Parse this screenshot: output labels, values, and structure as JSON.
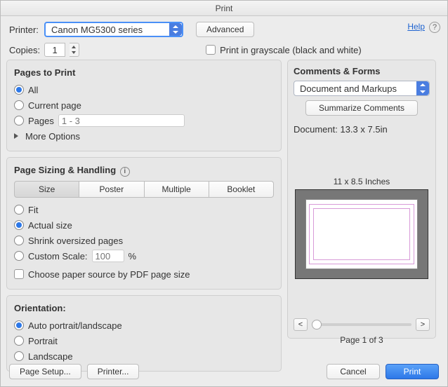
{
  "window": {
    "title": "Print"
  },
  "help": "Help",
  "top": {
    "printer_label": "Printer:",
    "printer_value": "Canon MG5300 series",
    "advanced": "Advanced",
    "copies_label": "Copies:",
    "copies_value": "1",
    "grayscale": "Print in grayscale (black and white)"
  },
  "pages": {
    "title": "Pages to Print",
    "all": "All",
    "current": "Current page",
    "pages_label": "Pages",
    "pages_placeholder": "1 - 3",
    "more": "More Options"
  },
  "sizing": {
    "title": "Page Sizing & Handling",
    "tabs": {
      "size": "Size",
      "poster": "Poster",
      "multiple": "Multiple",
      "booklet": "Booklet"
    },
    "fit": "Fit",
    "actual": "Actual size",
    "shrink": "Shrink oversized pages",
    "custom_label": "Custom Scale:",
    "custom_value": "100",
    "custom_suffix": "%",
    "paper_source": "Choose paper source by PDF page size"
  },
  "orient": {
    "title": "Orientation:",
    "auto": "Auto portrait/landscape",
    "portrait": "Portrait",
    "landscape": "Landscape"
  },
  "right": {
    "title": "Comments & Forms",
    "dropdown": "Document and Markups",
    "summarize": "Summarize Comments",
    "doc_label": "Document: 13.3 x 7.5in",
    "preview_label": "11 x 8.5 Inches",
    "prev": "<",
    "next": ">",
    "page_of": "Page 1 of 3"
  },
  "footer": {
    "page_setup": "Page Setup...",
    "printer": "Printer...",
    "cancel": "Cancel",
    "print": "Print"
  }
}
